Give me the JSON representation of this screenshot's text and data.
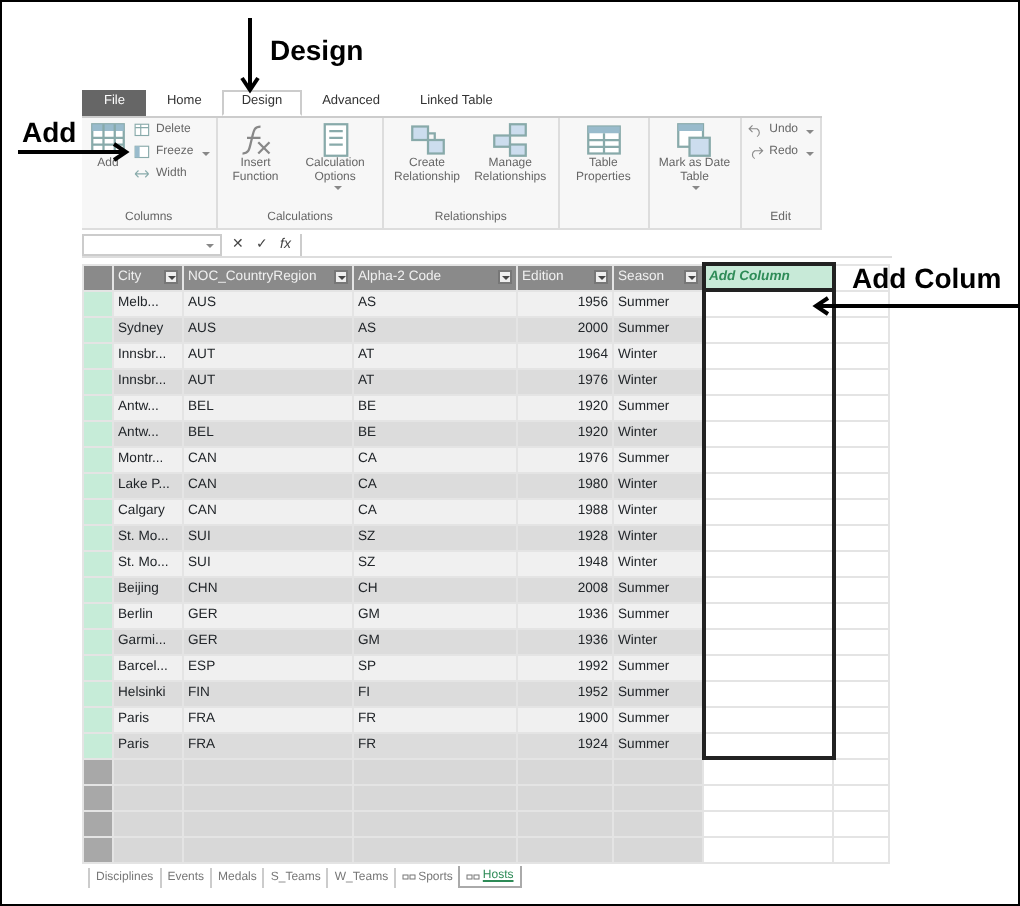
{
  "annotations": [
    {
      "text": "Design"
    },
    {
      "text": "Add"
    },
    {
      "text": "Add Colum"
    }
  ],
  "ribbon": {
    "tabs": [
      {
        "label": "File",
        "kind": "file",
        "selected": false
      },
      {
        "label": "Home",
        "kind": "tab",
        "selected": false
      },
      {
        "label": "Design",
        "kind": "tab",
        "selected": true
      },
      {
        "label": "Advanced",
        "kind": "tab",
        "selected": false
      },
      {
        "label": "Linked Table",
        "kind": "tab",
        "selected": false
      }
    ],
    "groups": [
      {
        "label": "Columns",
        "buttons": [
          {
            "label": "Add",
            "dropdown": false
          },
          {
            "label": "Delete",
            "dropdown": false
          },
          {
            "label": "Freeze",
            "dropdown": true
          },
          {
            "label": "Width",
            "dropdown": false
          }
        ]
      },
      {
        "label": "Calculations",
        "buttons": [
          {
            "label": "Insert Function",
            "dropdown": false
          },
          {
            "label": "Calculation Options",
            "dropdown": true
          }
        ]
      },
      {
        "label": "Relationships",
        "buttons": [
          {
            "label": "Create Relationship",
            "dropdown": false
          },
          {
            "label": "Manage Relationships",
            "dropdown": false
          }
        ]
      },
      {
        "buttons": [
          {
            "label": "Table Properties",
            "dropdown": false
          }
        ]
      },
      {
        "buttons": [
          {
            "label": "Mark as Date Table",
            "dropdown": true
          }
        ]
      },
      {
        "label": "Edit",
        "buttons": [
          {
            "label": "Undo",
            "dropdown": true
          },
          {
            "label": "Redo",
            "dropdown": true
          }
        ]
      }
    ]
  },
  "formula_bar": {
    "buttons": [
      "✕",
      "✓",
      "fx"
    ]
  },
  "table": {
    "columns": [
      {
        "label": "City",
        "kind": "text"
      },
      {
        "label": "NOC_CountryRegion",
        "kind": "text"
      },
      {
        "label": "Alpha-2 Code",
        "kind": "text"
      },
      {
        "label": "Edition",
        "kind": "number"
      },
      {
        "label": "Season",
        "kind": "text"
      },
      {
        "label": "Add Column",
        "kind": "add"
      }
    ],
    "rows": [
      [
        "Melb...",
        "AUS",
        "AS",
        "1956",
        "Summer"
      ],
      [
        "Sydney",
        "AUS",
        "AS",
        "2000",
        "Summer"
      ],
      [
        "Innsbr...",
        "AUT",
        "AT",
        "1964",
        "Winter"
      ],
      [
        "Innsbr...",
        "AUT",
        "AT",
        "1976",
        "Winter"
      ],
      [
        "Antw...",
        "BEL",
        "BE",
        "1920",
        "Summer"
      ],
      [
        "Antw...",
        "BEL",
        "BE",
        "1920",
        "Winter"
      ],
      [
        "Montr...",
        "CAN",
        "CA",
        "1976",
        "Summer"
      ],
      [
        "Lake P...",
        "CAN",
        "CA",
        "1980",
        "Winter"
      ],
      [
        "Calgary",
        "CAN",
        "CA",
        "1988",
        "Winter"
      ],
      [
        "St. Mo...",
        "SUI",
        "SZ",
        "1928",
        "Winter"
      ],
      [
        "St. Mo...",
        "SUI",
        "SZ",
        "1948",
        "Winter"
      ],
      [
        "Beijing",
        "CHN",
        "CH",
        "2008",
        "Summer"
      ],
      [
        "Berlin",
        "GER",
        "GM",
        "1936",
        "Summer"
      ],
      [
        "Garmi...",
        "GER",
        "GM",
        "1936",
        "Winter"
      ],
      [
        "Barcel...",
        "ESP",
        "SP",
        "1992",
        "Summer"
      ],
      [
        "Helsinki",
        "FIN",
        "FI",
        "1952",
        "Summer"
      ],
      [
        "Paris",
        "FRA",
        "FR",
        "1900",
        "Summer"
      ],
      [
        "Paris",
        "FRA",
        "FR",
        "1924",
        "Summer"
      ]
    ]
  },
  "sheet_tabs": [
    {
      "label": "Disciplines",
      "linked": false,
      "selected": false
    },
    {
      "label": "Events",
      "linked": false,
      "selected": false
    },
    {
      "label": "Medals",
      "linked": false,
      "selected": false
    },
    {
      "label": "S_Teams",
      "linked": false,
      "selected": false
    },
    {
      "label": "W_Teams",
      "linked": false,
      "selected": false
    },
    {
      "label": "Sports",
      "linked": true,
      "selected": false
    },
    {
      "label": "Hosts",
      "linked": true,
      "selected": true
    }
  ]
}
